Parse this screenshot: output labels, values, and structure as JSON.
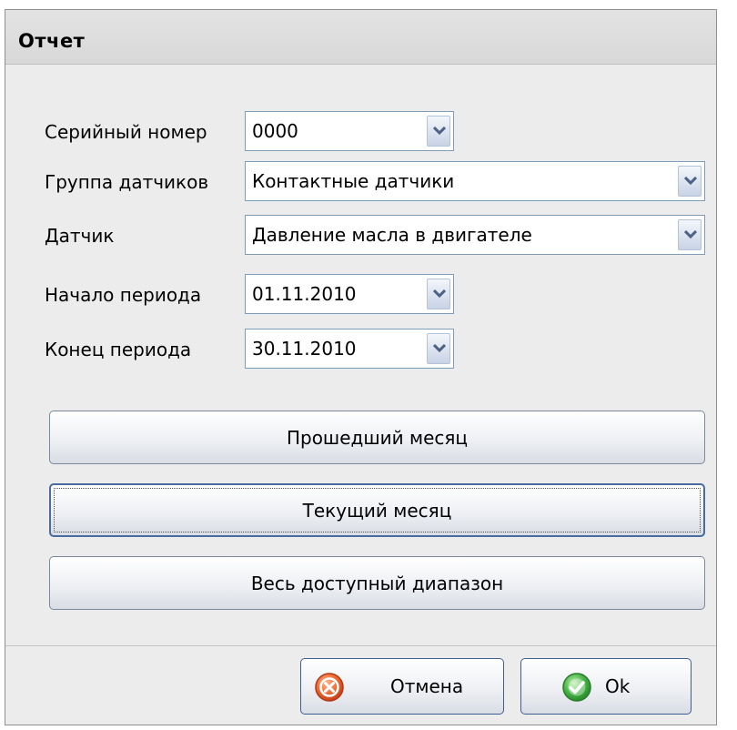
{
  "window": {
    "title": "Отчет"
  },
  "form": {
    "serial": {
      "label": "Серийный номер",
      "value": "0000"
    },
    "sensor_group": {
      "label": "Группа датчиков",
      "value": "Контактные датчики"
    },
    "sensor": {
      "label": "Датчик",
      "value": "Давление масла в двигателе"
    },
    "period_start": {
      "label": "Начало периода",
      "value": "01.11.2010"
    },
    "period_end": {
      "label": "Конец периода",
      "value": "30.11.2010"
    }
  },
  "buttons": {
    "last_month": "Прошедший месяц",
    "current_month": "Текущий месяц",
    "full_range": "Весь доступный диапазон"
  },
  "footer": {
    "cancel_label": "Отмена",
    "ok_label": "Ok"
  },
  "icons": {
    "cancel": "cancel-icon",
    "ok": "ok-check-icon",
    "dropdown": "chevron-down-icon"
  },
  "colors": {
    "cancel_icon": "#e8602c",
    "ok_icon": "#3caa3c",
    "dropdown_arrow": "#4d6185"
  }
}
